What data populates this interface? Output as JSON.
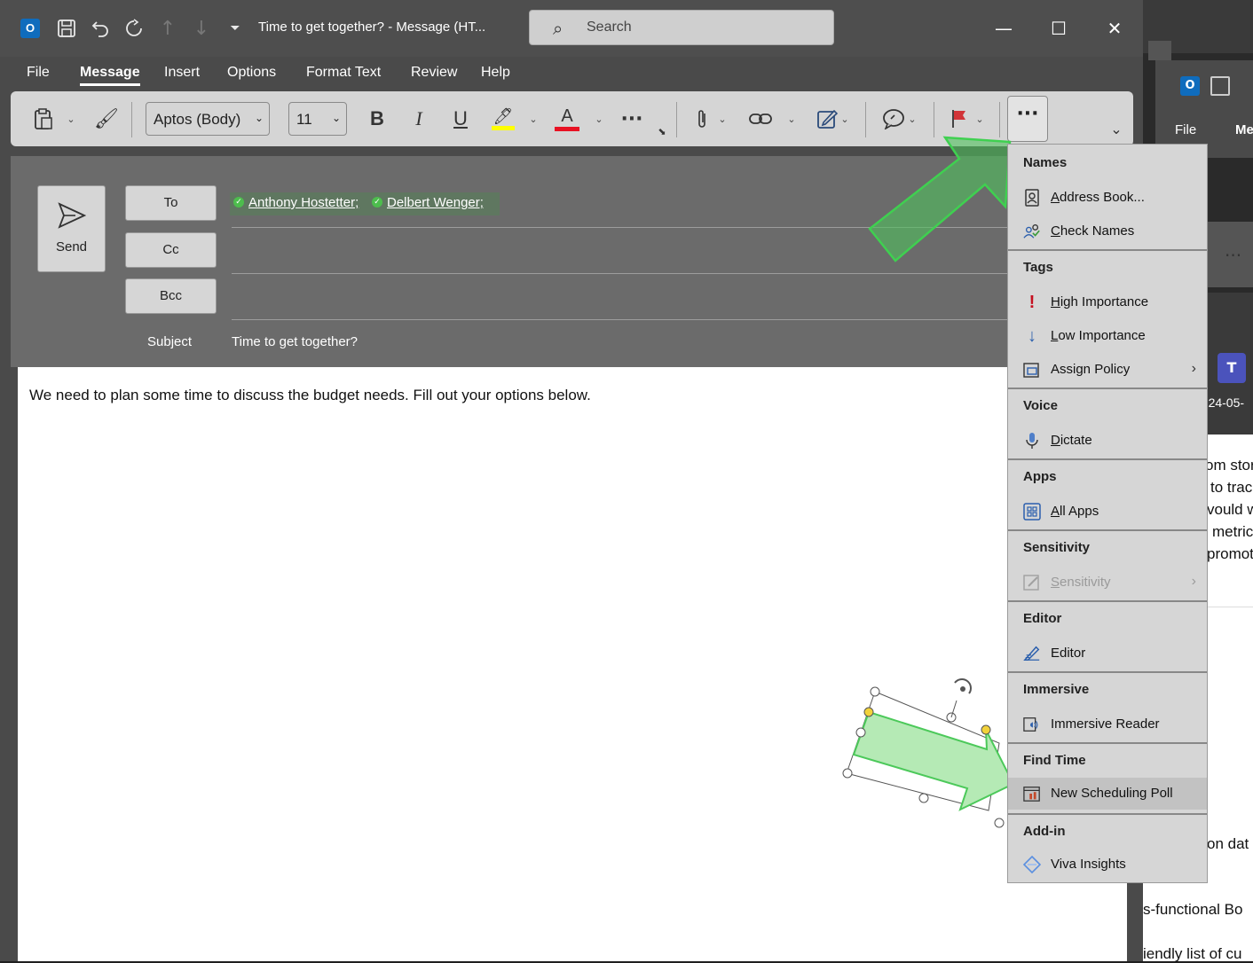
{
  "window": {
    "title": "Time to get together?  -  Message (HT...",
    "search_placeholder": "Search"
  },
  "menu_tabs": [
    "File",
    "Message",
    "Insert",
    "Options",
    "Format Text",
    "Review",
    "Help"
  ],
  "ribbon": {
    "font_name": "Aptos (Body)",
    "font_size": "11",
    "bold": "B",
    "italic": "I",
    "underline": "U",
    "font_color": "A",
    "more": "···"
  },
  "compose": {
    "send_label": "Send",
    "to_label": "To",
    "cc_label": "Cc",
    "bcc_label": "Bcc",
    "recipients": [
      "Anthony Hostetter;",
      "Delbert Wenger;"
    ],
    "subject_label": "Subject",
    "subject_value": "Time to get together?",
    "body_text": "We need to plan some time to discuss the budget needs. Fill out your options below."
  },
  "dropdown": {
    "names_header": "Names",
    "address_book": "Address Book...",
    "check_names": "Check Names",
    "tags_header": "Tags",
    "high_importance": "High Importance",
    "low_importance": "Low Importance",
    "assign_policy": "Assign Policy",
    "voice_header": "Voice",
    "dictate": "Dictate",
    "apps_header": "Apps",
    "all_apps": "All Apps",
    "sensitivity_header": "Sensitivity",
    "sensitivity": "Sensitivity",
    "editor_header": "Editor",
    "editor": "Editor",
    "immersive_header": "Immersive",
    "immersive_reader": "Immersive Reader",
    "findtime_header": "Find Time",
    "new_scheduling_poll": "New Scheduling Poll",
    "addin_header": "Add-in",
    "viva_insights": "Viva Insights"
  },
  "background_window": {
    "tab_file": "File",
    "tab_me": "Me",
    "date": "2024-05-",
    "text_lines": [
      "om stor",
      "to trac",
      "vould w",
      "metric",
      "promot",
      "on dat",
      "s-functional Bo",
      "iendly list of cu"
    ]
  },
  "colors": {
    "highlight_yellow": "#ffff00",
    "font_red": "#e81123",
    "arrow_green": "#5dd36a",
    "recipient_check": "#4dbd4d"
  }
}
